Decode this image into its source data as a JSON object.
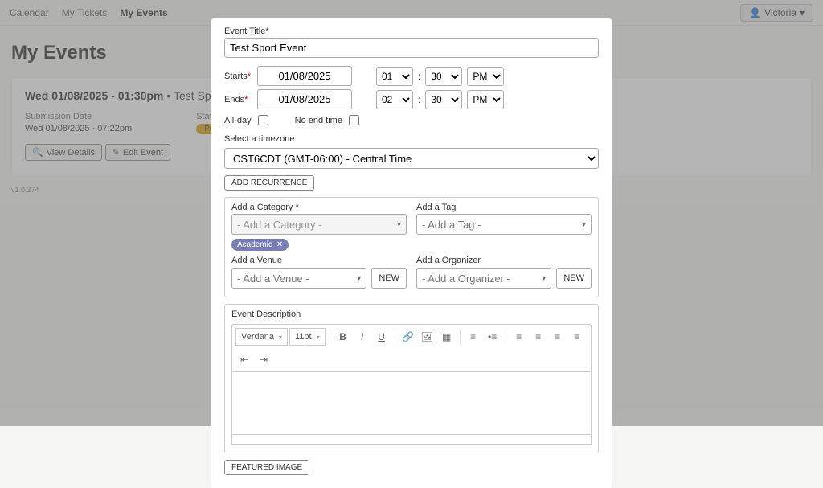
{
  "nav": {
    "links": [
      "Calendar",
      "My Tickets",
      "My Events"
    ],
    "active_index": 2,
    "user": "Victoria"
  },
  "page_title": "My Events",
  "event": {
    "date_time": "Wed 01/08/2025 - 01:30pm",
    "name": "Test Sport Event",
    "submission_label": "Submission Date",
    "submission_value": "Wed 01/08/2025 - 07:22pm",
    "status_label": "Status",
    "status_value": "Pending",
    "view_details": "View Details",
    "edit_event": "Edit Event"
  },
  "version": "v1.0.374",
  "modal": {
    "title_label": "Event Title*",
    "title_value": "Test Sport Event",
    "starts_label": "Starts",
    "ends_label": "Ends",
    "start_date": "01/08/2025",
    "end_date": "01/08/2025",
    "start_hour": "01",
    "start_min": "30",
    "start_ampm": "PM",
    "end_hour": "02",
    "end_min": "30",
    "end_ampm": "PM",
    "allday": "All-day",
    "noend": "No end time",
    "tz_label": "Select a timezone",
    "tz_value": "CST6CDT (GMT-06:00) - Central Time",
    "add_recurrence": "ADD RECURRENCE",
    "cat_label": "Add a Category *",
    "cat_placeholder": "- Add a Category -",
    "cat_chip": "Academic",
    "tag_label": "Add a Tag",
    "tag_placeholder": "- Add a Tag -",
    "venue_label": "Add a Venue",
    "venue_placeholder": "- Add a Venue -",
    "org_label": "Add a Organizer",
    "org_placeholder": "- Add a Organizer -",
    "new_btn": "NEW",
    "desc_label": "Event Description",
    "font_family": "Verdana",
    "font_size": "11pt",
    "featured_image": "FEATURED IMAGE"
  }
}
